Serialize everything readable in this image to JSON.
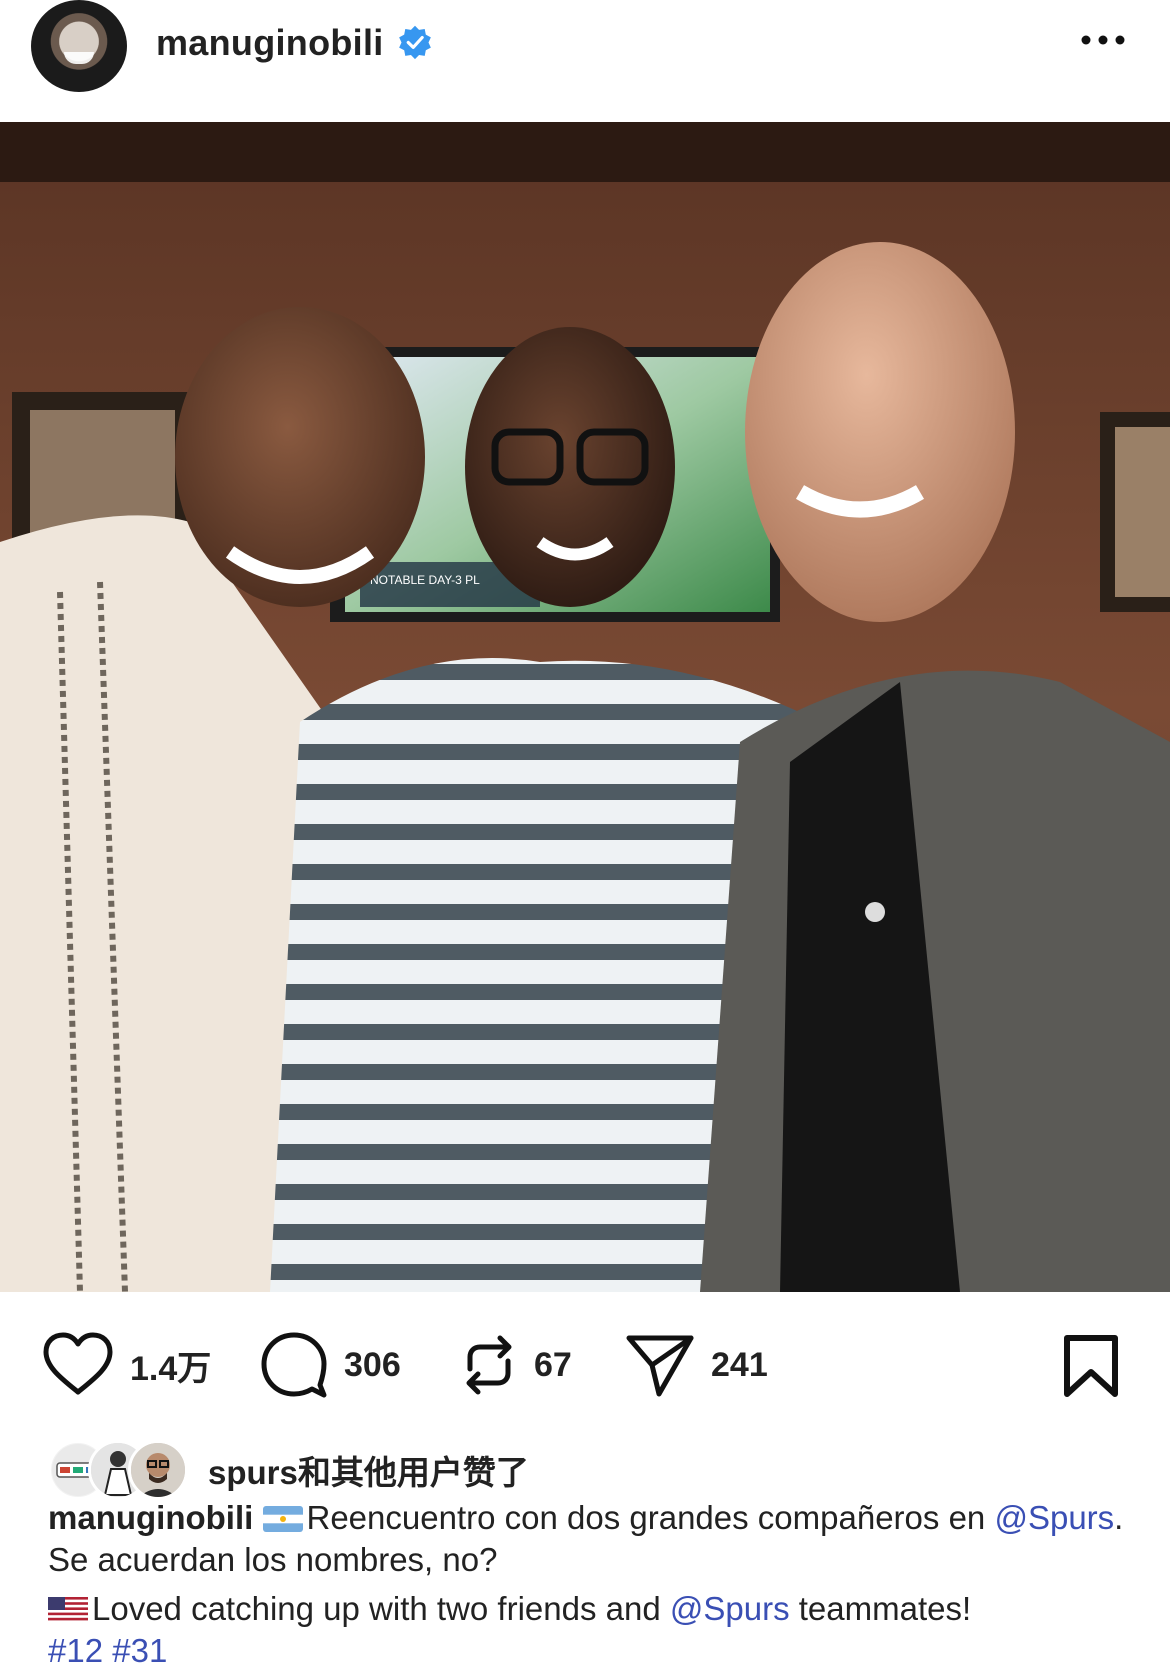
{
  "post": {
    "username": "manuginobili",
    "verified": true
  },
  "photo": {
    "tv_caption": "NOTABLE DAY-3 PL"
  },
  "actions": {
    "likes": "1.4万",
    "comments": "306",
    "reposts": "67",
    "shares": "241"
  },
  "liked_by": {
    "text": "spurs和其他用户赞了"
  },
  "caption": {
    "username": "manuginobili",
    "line1_text": "Reencuentro con dos grandes compañeros en",
    "mention1": "@Spurs",
    "line2_text": ". Se acuerdan los nombres, no?",
    "line3_text": "Loved catching up with two friends and",
    "mention2": "@Spurs",
    "line3_end": " teammates!",
    "hashtag1": "#12",
    "hashtag2": "#31"
  },
  "icons": {
    "more": "more-horizontal-icon",
    "like": "heart-icon",
    "comment": "comment-bubble-icon",
    "repost": "repost-icon",
    "share": "send-icon",
    "save": "bookmark-icon"
  },
  "colors": {
    "verified": "#3797f0",
    "link": "#3a4fb4",
    "text": "#222222"
  }
}
